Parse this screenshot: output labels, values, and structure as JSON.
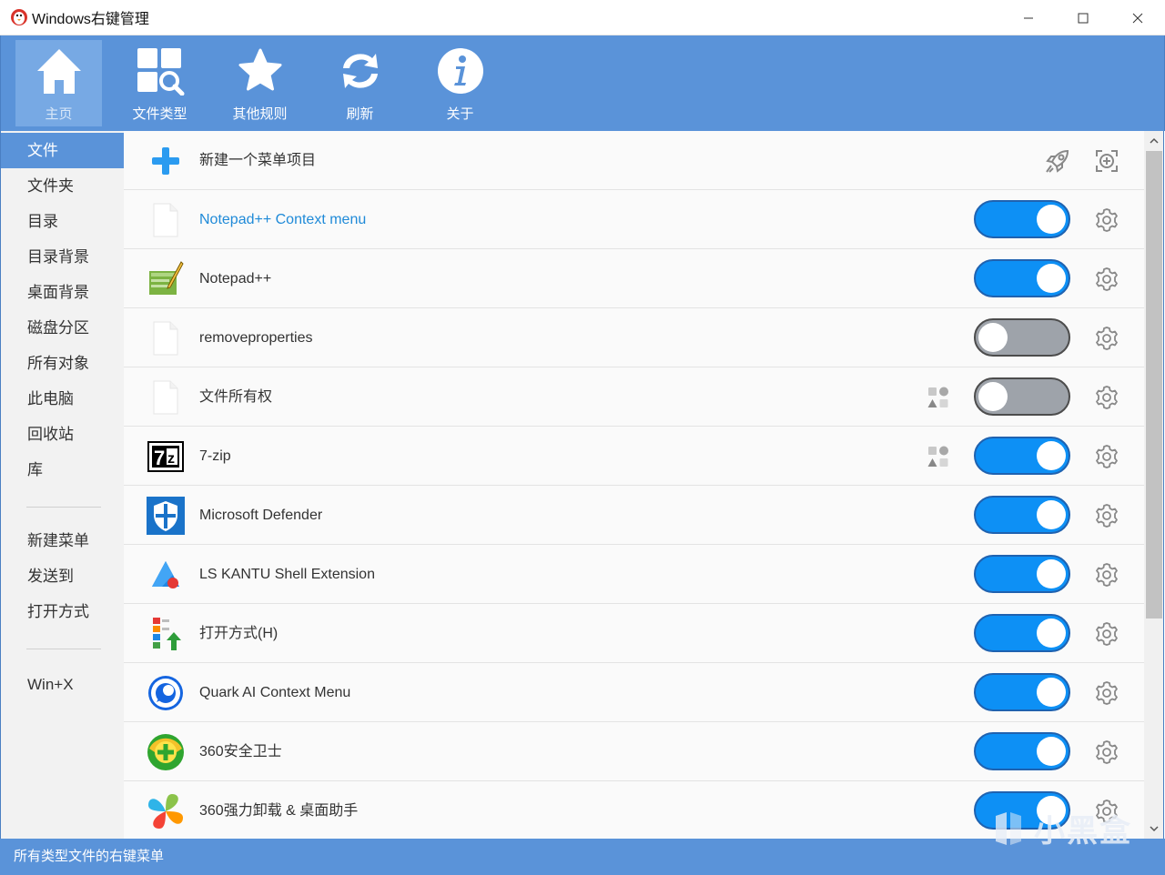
{
  "window": {
    "title": "Windows右键管理",
    "controls": [
      "minimize-icon",
      "maximize-icon",
      "close-icon"
    ]
  },
  "toolbar": {
    "items": [
      {
        "label": "主页",
        "icon": "home-icon",
        "active": true
      },
      {
        "label": "文件类型",
        "icon": "file-types-icon",
        "active": false
      },
      {
        "label": "其他规则",
        "icon": "star-icon",
        "active": false
      },
      {
        "label": "刷新",
        "icon": "refresh-icon",
        "active": false
      },
      {
        "label": "关于",
        "icon": "info-icon",
        "active": false
      }
    ]
  },
  "sidebar": {
    "items": [
      {
        "label": "文件",
        "active": true
      },
      {
        "label": "文件夹"
      },
      {
        "label": "目录"
      },
      {
        "label": "目录背景"
      },
      {
        "label": "桌面背景"
      },
      {
        "label": "磁盘分区"
      },
      {
        "label": "所有对象"
      },
      {
        "label": "此电脑"
      },
      {
        "label": "回收站"
      },
      {
        "label": "库"
      },
      {
        "label": "新建菜单"
      },
      {
        "label": "发送到"
      },
      {
        "label": "打开方式"
      },
      {
        "label": "Win+X"
      }
    ]
  },
  "list": {
    "new_item": {
      "label": "新建一个菜单项目",
      "icons": [
        "rocket-icon",
        "add-circle-icon"
      ]
    },
    "rows": [
      {
        "label": "Notepad++ Context menu",
        "icon": "blank-file-icon",
        "enabled": true,
        "highlight": true
      },
      {
        "label": "Notepad++",
        "icon": "notepadpp-icon",
        "enabled": true
      },
      {
        "label": "removeproperties",
        "icon": "blank-file-icon",
        "enabled": false
      },
      {
        "label": "文件所有权",
        "icon": "blank-file-icon",
        "enabled": false,
        "shapes": true
      },
      {
        "label": "7-zip",
        "icon": "7zip-icon",
        "enabled": true,
        "shapes": true
      },
      {
        "label": "Microsoft Defender",
        "icon": "defender-shield-icon",
        "enabled": true
      },
      {
        "label": "LS KANTU Shell Extension",
        "icon": "kantu-icon",
        "enabled": true
      },
      {
        "label": "打开方式(H)",
        "icon": "open-with-icon",
        "enabled": true
      },
      {
        "label": "Quark AI Context Menu",
        "icon": "quark-icon",
        "enabled": true
      },
      {
        "label": "360安全卫士",
        "icon": "360-safe-icon",
        "enabled": true
      },
      {
        "label": "360强力卸载 & 桌面助手",
        "icon": "360-uninstall-icon",
        "enabled": true
      }
    ]
  },
  "statusbar": {
    "text": "所有类型文件的右键菜单"
  },
  "watermark": {
    "text": "小黑盒"
  },
  "colors": {
    "accent": "#5a93d9",
    "toggle_on": "#0d90f5",
    "toggle_off": "#9ea3aa",
    "link": "#1f8ad8"
  }
}
